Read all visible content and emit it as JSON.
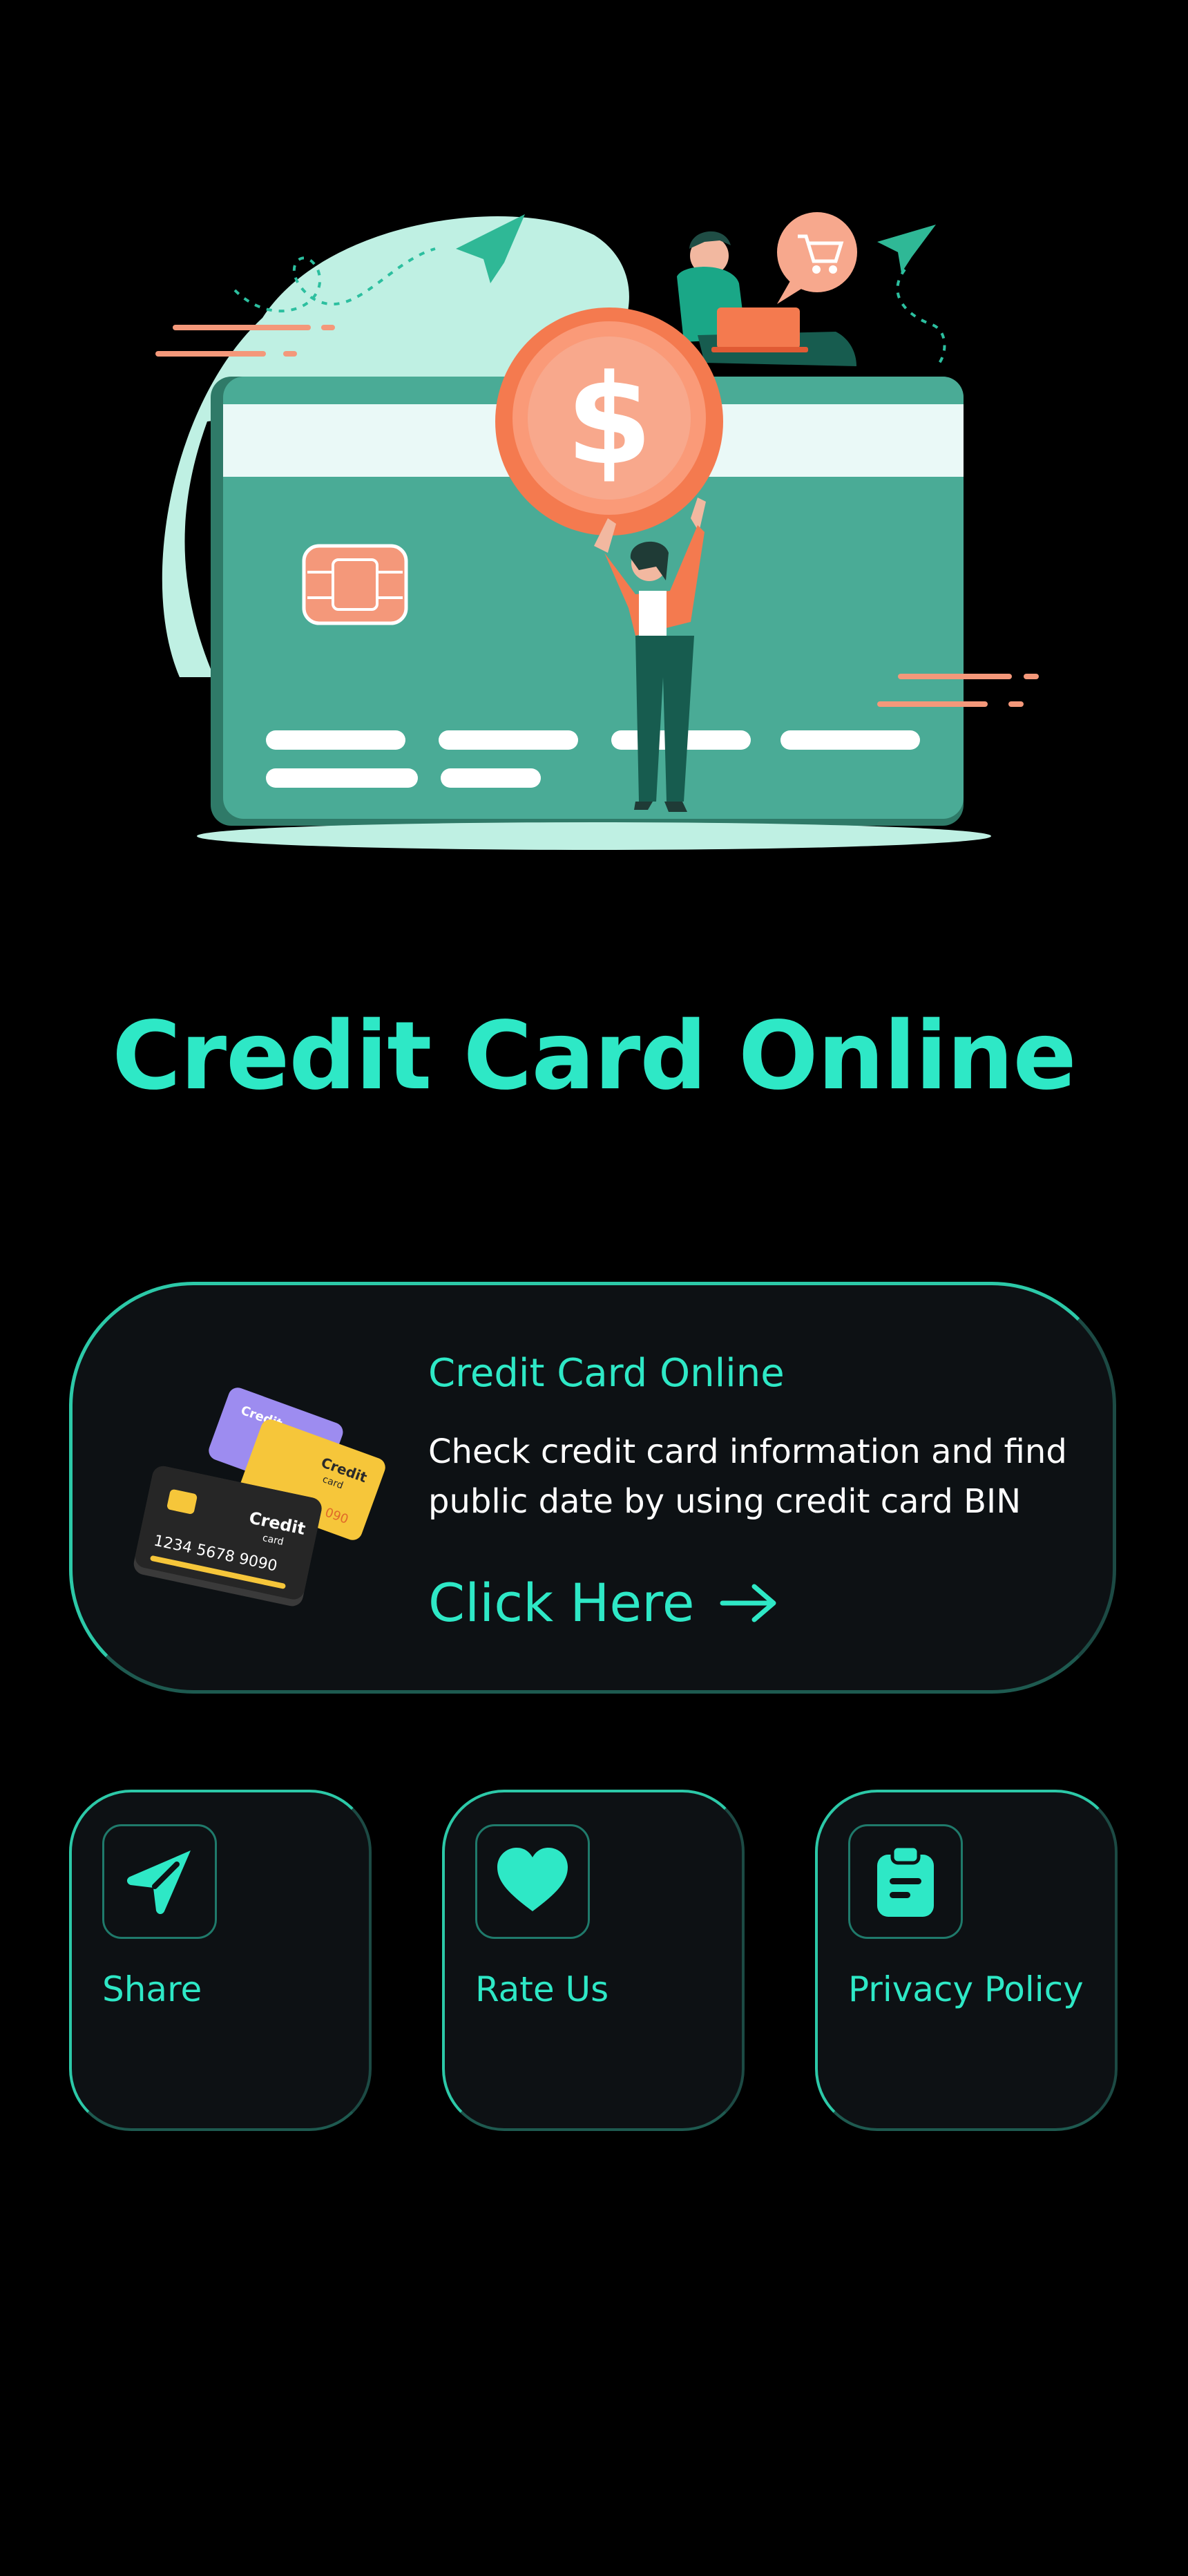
{
  "app": {
    "title": "Credit Card Online"
  },
  "colors": {
    "background": "#000000",
    "accent": "#2ee8c6",
    "card_background": "#0d1114",
    "card_teal": "#4aab96",
    "coin_orange": "#f47a4f"
  },
  "hero": {
    "icon": "credit-card-illustration"
  },
  "main_card": {
    "title": "Credit Card Online",
    "description": "Check credit card information and find public date by using credit card BIN",
    "link_label": "Click Here",
    "icon": "arrow-right-icon",
    "illustration": "stacked-credit-cards-illustration",
    "illustration_text": {
      "front_card_brand": "Credit",
      "front_card_subbrand": "card",
      "front_card_number": "1234 5678 9090",
      "middle_card_brand": "Credit",
      "middle_card_subbrand": "card",
      "middle_card_digits": "090",
      "back_card_brand": "Credit"
    }
  },
  "tiles": [
    {
      "label": "Share",
      "icon": "send-icon"
    },
    {
      "label": "Rate Us",
      "icon": "heart-icon"
    },
    {
      "label": "Privacy Policy",
      "icon": "clipboard-icon"
    }
  ]
}
